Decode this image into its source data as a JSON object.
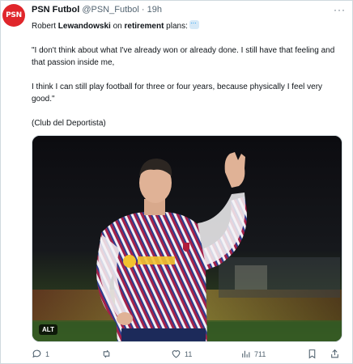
{
  "post": {
    "avatar_text": "PSN",
    "author_name": "PSN Futbol",
    "author_handle": "@PSN_Futbol",
    "separator": "·",
    "time": "19h",
    "more_icon": "more-icon",
    "intro_prefix": "Robert ",
    "intro_bold1": "Lewandowski",
    "intro_middle": " on ",
    "intro_bold2": "retirement",
    "intro_suffix": " plans:",
    "quote1": "\"I don't think about what I've already won or already done. I still have that feeling and that passion inside me,",
    "quote2": "I think I can still play football for three or four years, because physically I feel very good.\"",
    "source": "(Club del Deportista)",
    "alt_label": "ALT"
  },
  "actions": {
    "replies": "1",
    "reposts": "",
    "likes": "11",
    "views": "711"
  },
  "colors": {
    "brand": "#e0262b",
    "muted": "#536471",
    "accent": "#1d9bf0"
  }
}
